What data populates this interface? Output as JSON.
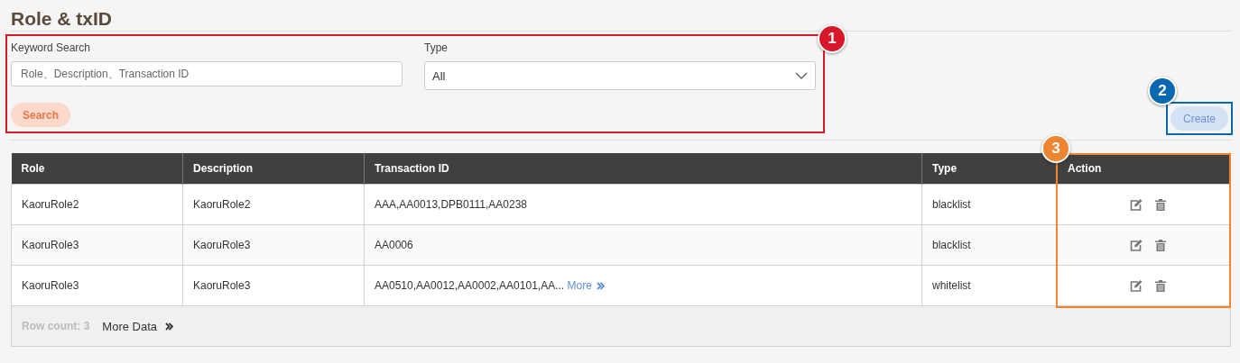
{
  "page_title": "Role & txID",
  "search_panel": {
    "callout": {
      "number": "1",
      "color": "#d7182a"
    },
    "keyword": {
      "label": "Keyword Search",
      "placeholder": "Role、Description、Transaction ID"
    },
    "type": {
      "label": "Type",
      "value": "All"
    },
    "search_button": "Search"
  },
  "create": {
    "label": "Create",
    "callout": {
      "number": "2",
      "color": "#0868b0"
    }
  },
  "table": {
    "columns": [
      "Role",
      "Description",
      "Transaction ID",
      "Type",
      "Action"
    ],
    "action_callout": {
      "number": "3",
      "color": "#ef8431"
    },
    "rows": [
      {
        "role": "KaoruRole2",
        "description": "KaoruRole2",
        "transaction_id": "AAA,AA0013,DPB0111,AA0238",
        "type": "blacklist"
      },
      {
        "role": "KaoruRole3",
        "description": "KaoruRole3",
        "transaction_id": "AA0006",
        "type": "blacklist"
      },
      {
        "role": "KaoruRole3",
        "description": "KaoruRole3",
        "transaction_id": "AA0510,AA0012,AA0002,AA0101,AA...",
        "more_link": "More",
        "type": "whitelist"
      }
    ],
    "footer": {
      "row_count": "Row count: 3",
      "more_data": "More Data"
    }
  }
}
